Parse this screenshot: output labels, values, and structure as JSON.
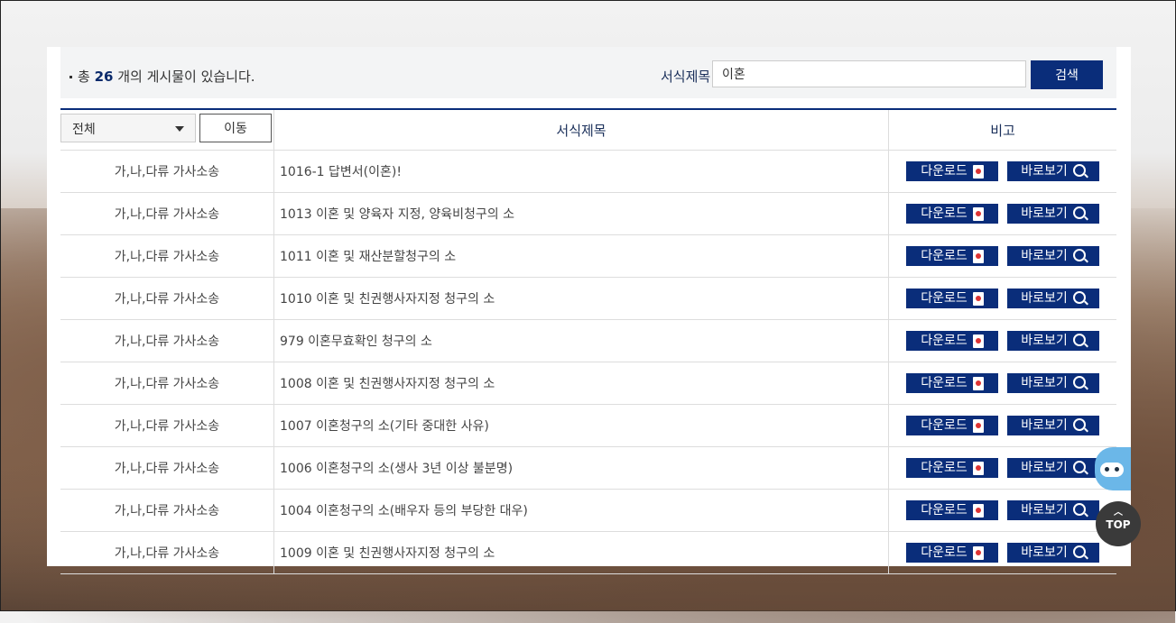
{
  "summary": {
    "prefix": "총",
    "count": "26",
    "suffix": "개의 게시물이 있습니다."
  },
  "search": {
    "label": "서식제목",
    "value": "이혼",
    "button": "검색"
  },
  "table": {
    "filter_selected": "전체",
    "move_button": "이동",
    "header_title": "서식제목",
    "header_note": "비고",
    "download_label": "다운로드",
    "view_label": "바로보기",
    "rows": [
      {
        "category": "가,나,다류 가사소송",
        "title": "1016-1 답변서(이혼)!"
      },
      {
        "category": "가,나,다류 가사소송",
        "title": "1013 이혼 및 양육자 지정, 양육비청구의 소"
      },
      {
        "category": "가,나,다류 가사소송",
        "title": "1011 이혼 및 재산분할청구의 소"
      },
      {
        "category": "가,나,다류 가사소송",
        "title": "1010 이혼 및 친권행사자지정 청구의 소"
      },
      {
        "category": "가,나,다류 가사소송",
        "title": "979 이혼무효확인 청구의 소"
      },
      {
        "category": "가,나,다류 가사소송",
        "title": "1008 이혼 및 친권행사자지정 청구의 소"
      },
      {
        "category": "가,나,다류 가사소송",
        "title": "1007 이혼청구의 소(기타 중대한 사유)"
      },
      {
        "category": "가,나,다류 가사소송",
        "title": "1006 이혼청구의 소(생사 3년 이상 불분명)"
      },
      {
        "category": "가,나,다류 가사소송",
        "title": "1004 이혼청구의 소(배우자 등의 부당한 대우)"
      },
      {
        "category": "가,나,다류 가사소송",
        "title": "1009 이혼 및 친권행사자지정 청구의 소"
      }
    ]
  },
  "floating": {
    "top_label": "TOP"
  },
  "colors": {
    "accent": "#0a2d7a",
    "text_dark": "#1a2f5a"
  }
}
